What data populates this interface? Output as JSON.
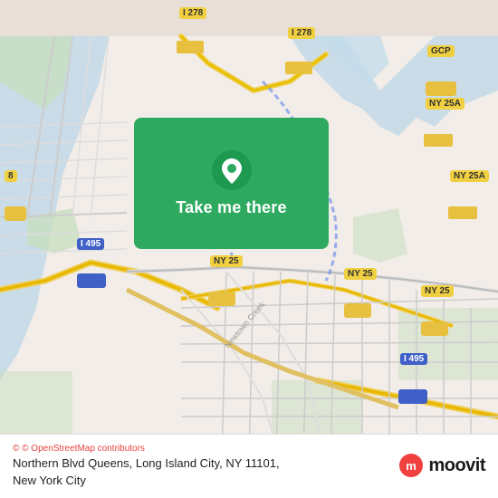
{
  "map": {
    "background_color": "#e8e0d8"
  },
  "card": {
    "label": "Take me there",
    "background_color": "#2daa5f"
  },
  "bottom_bar": {
    "attribution": "© OpenStreetMap contributors",
    "address": "Northern Blvd Queens, Long Island City, NY 11101,",
    "city": "New York City",
    "brand": "moovit"
  }
}
